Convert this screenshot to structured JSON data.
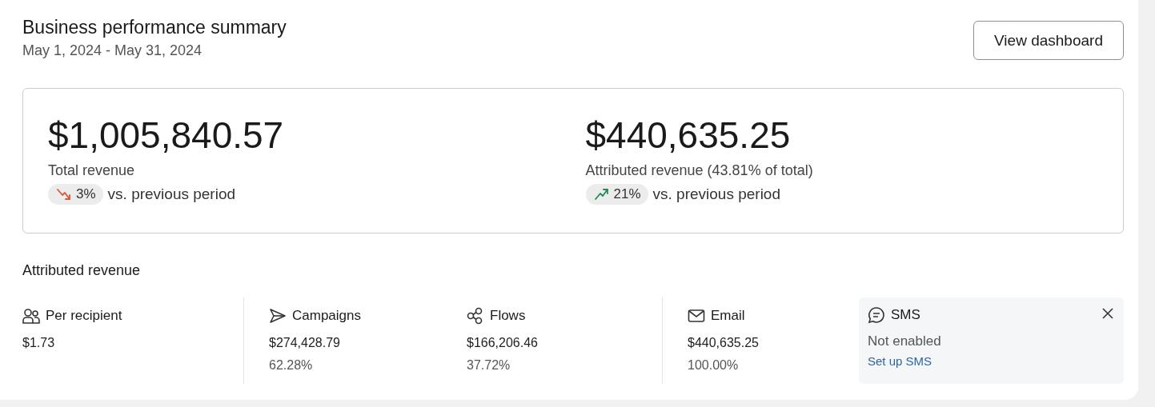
{
  "header": {
    "title": "Business performance summary",
    "date_range": "May 1, 2024 - May 31, 2024",
    "button": "View dashboard"
  },
  "summary": [
    {
      "value": "$1,005,840.57",
      "label": "Total revenue",
      "change": {
        "kind": "down",
        "percent": "3%",
        "text": "vs. previous period"
      }
    },
    {
      "value": "$440,635.25",
      "label": "Attributed revenue (43.81% of total)",
      "change": {
        "kind": "up",
        "percent": "21%",
        "text": "vs. previous period"
      }
    }
  ],
  "attributed": {
    "title": "Attributed revenue",
    "groups": [
      [
        {
          "kind": "people",
          "label": "Per recipient",
          "value": "$1.73"
        }
      ],
      [
        {
          "kind": "send",
          "label": "Campaigns",
          "value": "$274,428.79",
          "share": "62.28%"
        },
        {
          "kind": "flows",
          "label": "Flows",
          "value": "$166,206.46",
          "share": "37.72%"
        }
      ],
      [
        {
          "kind": "mail",
          "label": "Email",
          "value": "$440,635.25",
          "share": "100.00%"
        }
      ]
    ],
    "sms": {
      "label": "SMS",
      "status": "Not enabled",
      "link": "Set up SMS"
    }
  }
}
